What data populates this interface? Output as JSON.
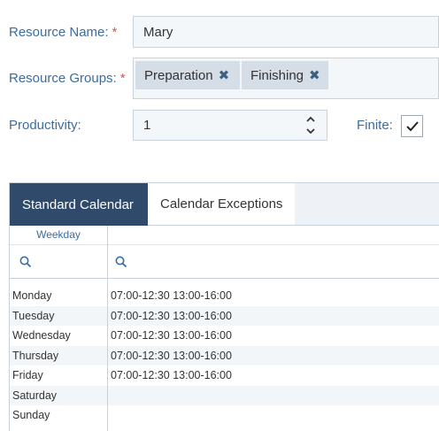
{
  "form": {
    "resource_name_label": "Resource Name:",
    "resource_name_value": "Mary",
    "resource_groups_label": "Resource Groups:",
    "resource_groups": [
      "Preparation",
      "Finishing"
    ],
    "productivity_label": "Productivity:",
    "productivity_value": "1",
    "finite_label": "Finite:",
    "finite_checked": true,
    "required_marker": "*"
  },
  "calendar": {
    "tabs": [
      "Standard Calendar",
      "Calendar Exceptions"
    ],
    "active_tab": 0,
    "column_header": "Weekday",
    "rows": [
      {
        "day": "Monday",
        "hours": "07:00-12:30 13:00-16:00"
      },
      {
        "day": "Tuesday",
        "hours": "07:00-12:30 13:00-16:00"
      },
      {
        "day": "Wednesday",
        "hours": "07:00-12:30 13:00-16:00"
      },
      {
        "day": "Thursday",
        "hours": "07:00-12:30 13:00-16:00"
      },
      {
        "day": "Friday",
        "hours": "07:00-12:30 13:00-16:00"
      },
      {
        "day": "Saturday",
        "hours": ""
      },
      {
        "day": "Sunday",
        "hours": ""
      }
    ]
  },
  "colors": {
    "label": "#3b6da0",
    "required": "#d9534f",
    "active_tab": "#2f4a6b",
    "tag_bg": "#d5dde6"
  }
}
